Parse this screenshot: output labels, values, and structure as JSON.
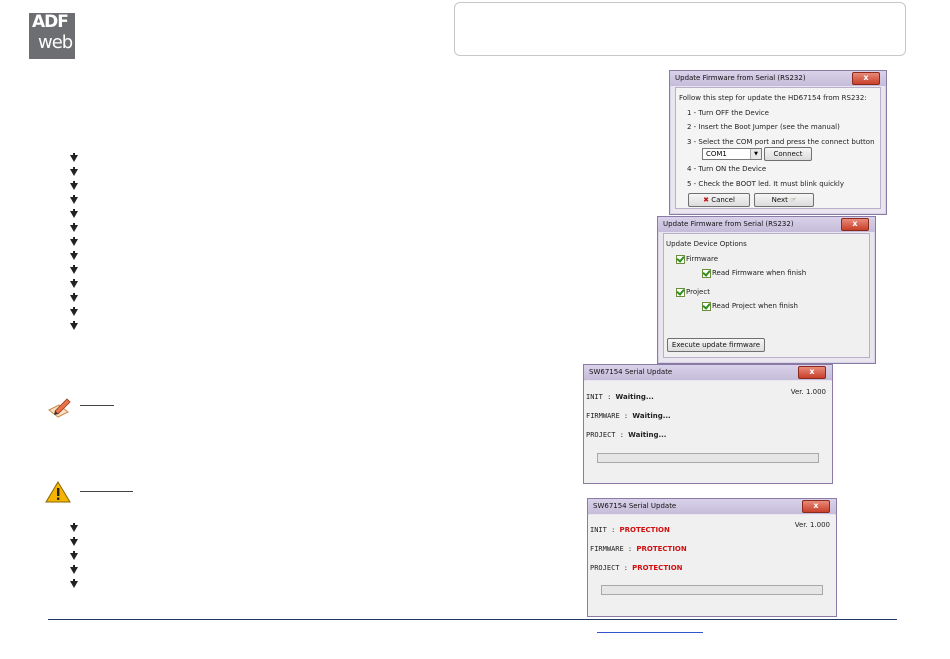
{
  "logo": {
    "line1": "ADF",
    "line2": "web"
  },
  "dialog1": {
    "title": "Update Firmware from Serial (RS232)",
    "close": "x",
    "intro": "Follow this step for update the HD67154 from RS232:",
    "step1": "1 - Turn OFF the Device",
    "step2": "2 - Insert the Boot Jumper (see the manual)",
    "step3": "3 - Select the  COM port and press the connect button",
    "com_value": "COM1",
    "connect": "Connect",
    "step4": "4 - Turn ON the Device",
    "step5": "5 - Check the BOOT led. It must blink quickly",
    "cancel": "Cancel",
    "next": "Next"
  },
  "dialog2": {
    "title": "Update Firmware from Serial (RS232)",
    "close": "x",
    "options_label": "Update Device Options",
    "firmware": "Firmware",
    "read_firmware": "Read Firmware when finish",
    "project": "Project",
    "read_project": "Read Project when finish",
    "execute": "Execute update firmware"
  },
  "dialog3": {
    "title": "SW67154 Serial Update",
    "close": "x",
    "version": "Ver. 1.000",
    "init_label": "INIT :",
    "init_value": "Waiting...",
    "fw_label": "FIRMWARE :",
    "fw_value": "Waiting...",
    "proj_label": "PROJECT :",
    "proj_value": "Waiting..."
  },
  "dialog4": {
    "title": "SW67154 Serial Update",
    "close": "x",
    "version": "Ver. 1.000",
    "init_label": "INIT :",
    "init_value": "PROTECTION",
    "fw_label": "FIRMWARE :",
    "fw_value": "PROTECTION",
    "proj_label": "PROJECT :",
    "proj_value": "PROTECTION"
  },
  "colors": {
    "footer_rule": "#1f3864",
    "protection": "#d01010",
    "logo_bg": "#6d6e71"
  }
}
